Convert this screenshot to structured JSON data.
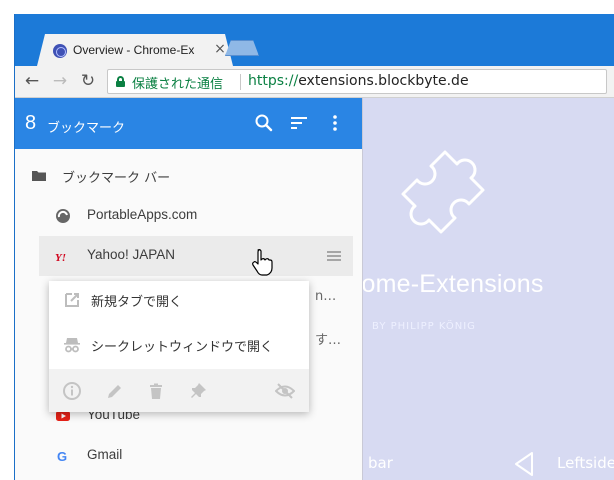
{
  "browser": {
    "tab_title": "Overview - Chrome-Ex",
    "tab_close": "×",
    "nav": {
      "back": "←",
      "forward": "→",
      "reload": "↻"
    },
    "security_label": "保護された通信",
    "url_scheme": "https://",
    "url_host": "extensions.blockbyte.de"
  },
  "page": {
    "hero_title": "rome-Extensions",
    "hero_byline": "BY PHILIPP KÖNIG",
    "bar_label": "bar",
    "leftside_label": "Leftside"
  },
  "popup": {
    "count": "8",
    "title": "ブックマーク",
    "header_icons": [
      "search-icon",
      "sort-icon",
      "more-vert-icon"
    ],
    "folder": "ブックマーク バー",
    "bookmarks": [
      {
        "label": "PortableApps.com",
        "icon": "portableapps-icon"
      },
      {
        "label": "Yahoo! JAPAN",
        "icon": "yahoo-icon"
      },
      {
        "label": "YouTube",
        "icon": "youtube-icon"
      },
      {
        "label": "Gmail",
        "icon": "gmail-icon"
      }
    ],
    "hidden_row_tails": [
      "n…",
      "す…"
    ],
    "colors": {
      "header": "#2a85e4",
      "page": "#d7daf2"
    }
  },
  "context_menu": {
    "items": [
      {
        "label": "新規タブで開く",
        "icon": "open-in-new-icon"
      },
      {
        "label": "シークレットウィンドウで開く",
        "icon": "incognito-icon"
      }
    ],
    "actions": [
      "info-icon",
      "edit-icon",
      "delete-icon",
      "pin-icon",
      "hide-icon"
    ]
  }
}
